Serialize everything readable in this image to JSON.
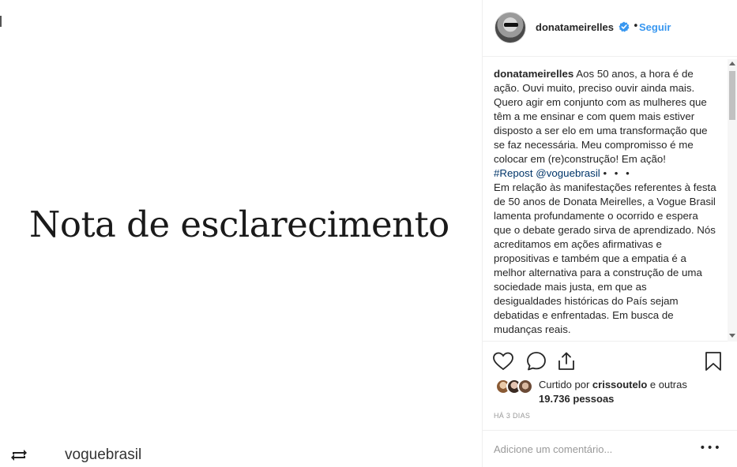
{
  "image": {
    "headline": "Nota de esclarecimento",
    "repost_username": "voguebrasil",
    "repost_icon": "repost-icon"
  },
  "header": {
    "username": "donatameirelles",
    "verified_icon": "verified-badge-icon",
    "separator": "•",
    "follow_label": "Seguir"
  },
  "caption": {
    "username": "donatameirelles",
    "text_1": " Aos 50 anos, a hora é de ação. Ouvi muito, preciso ouvir ainda mais. Quero agir em conjunto com as mulheres que têm a me ensinar e com quem mais estiver disposto a ser elo em uma transformação que se faz necessária. Meu compromisso é me colocar em (re)construção! Em ação!",
    "hashtag": "#Repost",
    "mention": "@voguebrasil",
    "dots": "• • •",
    "text_2": "Em relação às manifestações referentes à festa de 50 anos de Donata Meirelles, a Vogue Brasil lamenta profundamente o ocorrido e espera que o debate gerado sirva de aprendizado. Nós acreditamos em ações afirmativas e propositivas e também que a empatia é a melhor alternativa para a construção de uma sociedade mais justa, em que as desigualdades históricas do País sejam debatidas e enfrentadas. Em busca de mudanças reais."
  },
  "actions": {
    "like_icon": "heart-icon",
    "comment_icon": "comment-icon",
    "share_icon": "share-icon",
    "save_icon": "bookmark-icon"
  },
  "likes": {
    "prefix": "Curtido por ",
    "user": "crissoutelo",
    "middle": " e outras ",
    "count": "19.736 pessoas"
  },
  "timestamp": "HÁ 3 DIAS",
  "comment": {
    "placeholder": "Adicione um comentário...",
    "more_label": "•••"
  },
  "colors": {
    "link_blue": "#3897f0",
    "hashtag_blue": "#003569",
    "text": "#262626",
    "muted": "#999999"
  }
}
